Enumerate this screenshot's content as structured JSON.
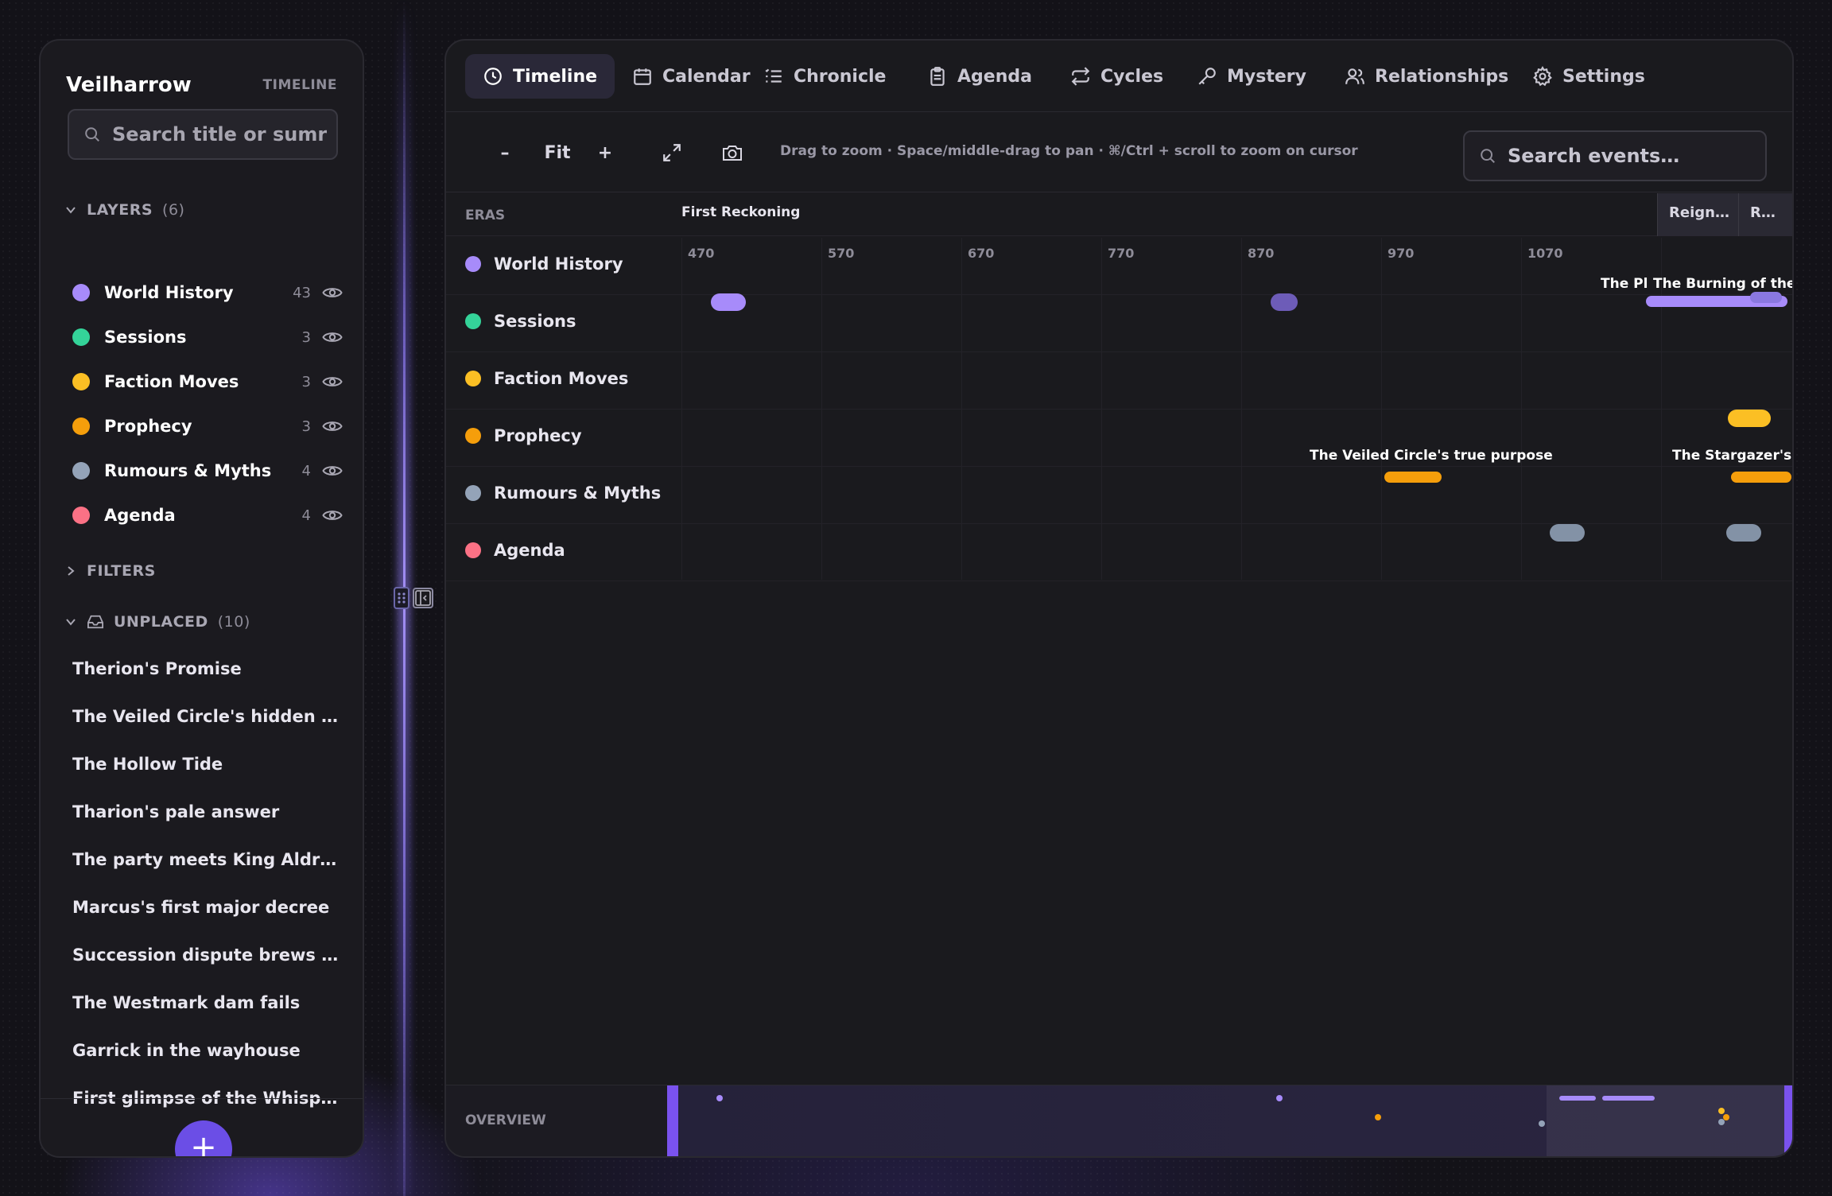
{
  "app": {
    "title": "Veilharrow",
    "view_label": "TIMELINE"
  },
  "sidebar": {
    "search_placeholder": "Search title or sumr",
    "layers": {
      "label": "LAYERS",
      "count": "(6)",
      "items": [
        {
          "name": "World History",
          "count": "43",
          "color": "#a78bfa"
        },
        {
          "name": "Sessions",
          "count": "3",
          "color": "#34d399"
        },
        {
          "name": "Faction Moves",
          "count": "3",
          "color": "#fbbf24"
        },
        {
          "name": "Prophecy",
          "count": "3",
          "color": "#f59e0b"
        },
        {
          "name": "Rumours & Myths",
          "count": "4",
          "color": "#94a3b8"
        },
        {
          "name": "Agenda",
          "count": "4",
          "color": "#fb7185"
        }
      ]
    },
    "filters_label": "FILTERS",
    "unplaced": {
      "label": "UNPLACED",
      "count": "(10)",
      "items": [
        "Therion's Promise",
        "The Veiled Circle's hidden archive",
        "The Hollow Tide",
        "Tharion's pale answer",
        "The party meets King Aldren",
        "Marcus's first major decree",
        "Succession dispute brews in the north",
        "The Westmark dam fails",
        "Garrick in the wayhouse",
        "First glimpse of the Whispered One"
      ]
    },
    "add_label": "+"
  },
  "tabs": [
    {
      "label": "Timeline",
      "icon": "clock-icon",
      "active": true
    },
    {
      "label": "Calendar",
      "icon": "calendar-icon"
    },
    {
      "label": "Chronicle",
      "icon": "list-icon"
    },
    {
      "label": "Agenda",
      "icon": "clipboard-icon"
    },
    {
      "label": "Cycles",
      "icon": "repeat-icon"
    },
    {
      "label": "Mystery",
      "icon": "key-icon"
    },
    {
      "label": "Relationships",
      "icon": "users-icon"
    },
    {
      "label": "Settings",
      "icon": "gear-icon"
    }
  ],
  "toolbar": {
    "zoom_out": "–",
    "fit": "Fit",
    "zoom_in": "+",
    "hint": "Drag to zoom · Space/middle-drag to pan · ⌘/Ctrl + scroll to zoom on cursor",
    "search_placeholder": "Search events…"
  },
  "timeline": {
    "eras_label": "ERAS",
    "eras": [
      {
        "name": "First Reckoning"
      },
      {
        "name": "Reign…"
      },
      {
        "name": "R…"
      }
    ],
    "ticks": [
      "470",
      "570",
      "670",
      "770",
      "870",
      "970",
      "1070"
    ],
    "lanes": [
      "World History",
      "Sessions",
      "Faction Moves",
      "Prophecy",
      "Rumours & Myths",
      "Agenda"
    ],
    "event_labels": {
      "wh_1": "The Pl",
      "wh_2": "The Burning of the Sc",
      "pr_1": "The Veiled Circle's true purpose",
      "pr_2": "The Stargazer's Pro"
    },
    "overview_label": "OVERVIEW"
  }
}
